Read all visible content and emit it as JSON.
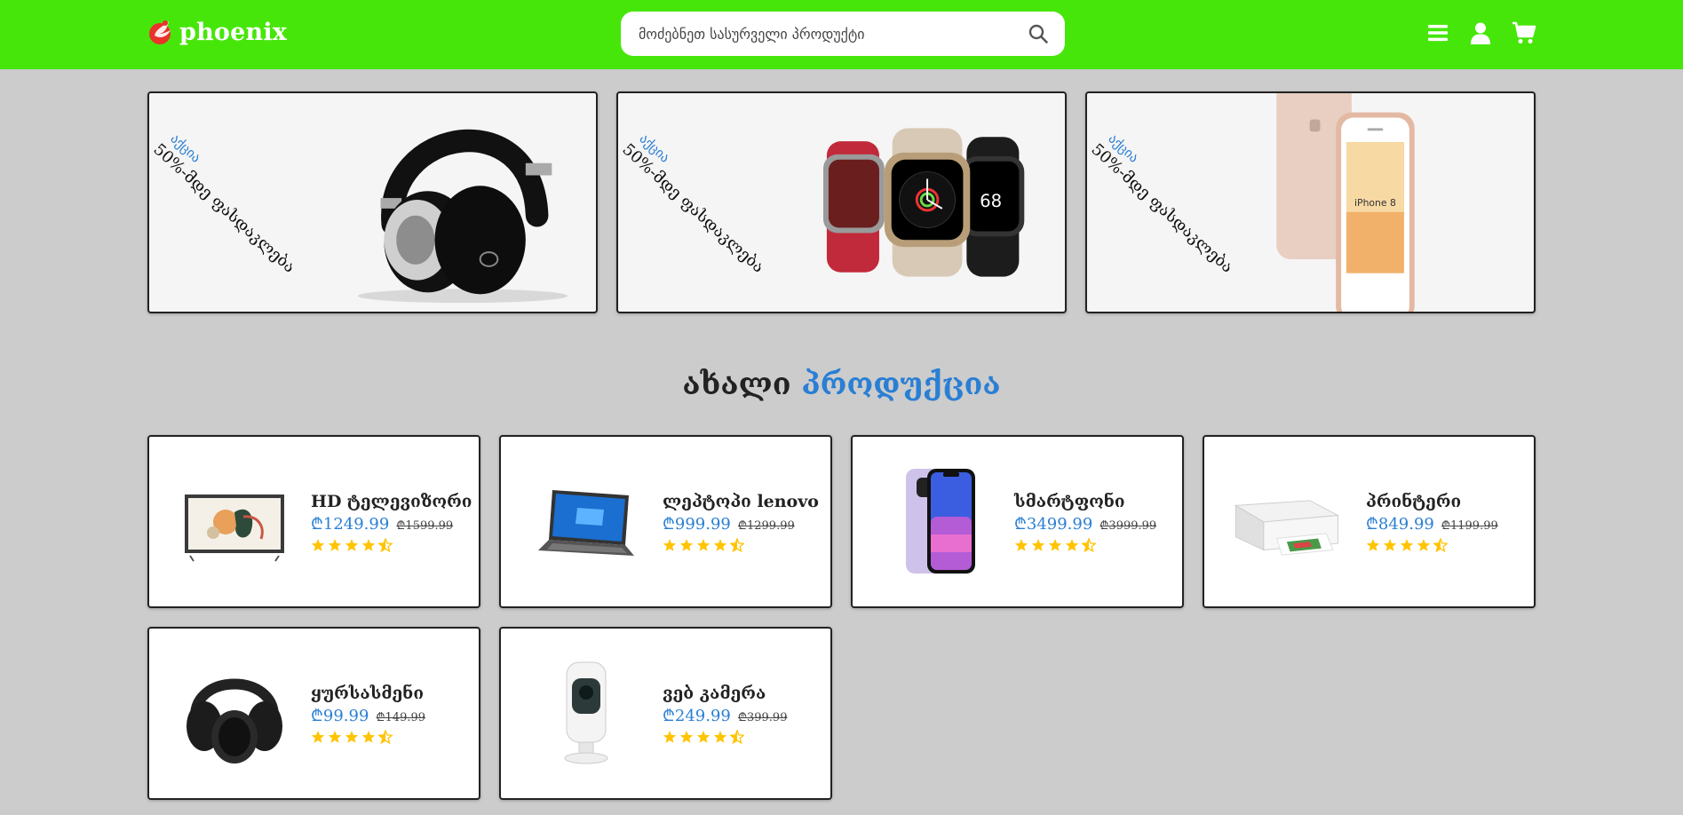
{
  "header": {
    "logo_text": "phoenix",
    "search_placeholder": "მოძებნეთ სასურველი პროდუქტი",
    "colors": {
      "header_bg": "#47e60a",
      "accent": "#2a7fd4"
    },
    "icons": [
      "search-icon",
      "menu-icon",
      "user-icon",
      "cart-icon"
    ]
  },
  "banners": [
    {
      "tag": "აქცია",
      "text": "50%-მდე ფასდაკლება",
      "product": "headphones"
    },
    {
      "tag": "აქცია",
      "text": "50%-მდე ფასდაკლება",
      "product": "smart watches"
    },
    {
      "tag": "აქცია",
      "text": "50%-მდე ფასდაკლება",
      "product": "iPhone",
      "device_label": "iPhone 8"
    }
  ],
  "section": {
    "title_plain": "ახალი",
    "title_accent": "პროდუქცია"
  },
  "products": [
    {
      "name": "HD ტელევიზორი",
      "price": "₾1249.99",
      "old_price": "₾1599.99",
      "rating": 4.5
    },
    {
      "name": "ლეპტოპი lenovo",
      "price": "₾999.99",
      "old_price": "₾1299.99",
      "rating": 4.5
    },
    {
      "name": "სმარტფონი",
      "price": "₾3499.99",
      "old_price": "₾3999.99",
      "rating": 4.5
    },
    {
      "name": "პრინტერი",
      "price": "₾849.99",
      "old_price": "₾1199.99",
      "rating": 4.5
    },
    {
      "name": "ყურსასმენი",
      "price": "₾99.99",
      "old_price": "₾149.99",
      "rating": 4.5
    },
    {
      "name": "ვებ კამერა",
      "price": "₾249.99",
      "old_price": "₾399.99",
      "rating": 4.5
    }
  ]
}
